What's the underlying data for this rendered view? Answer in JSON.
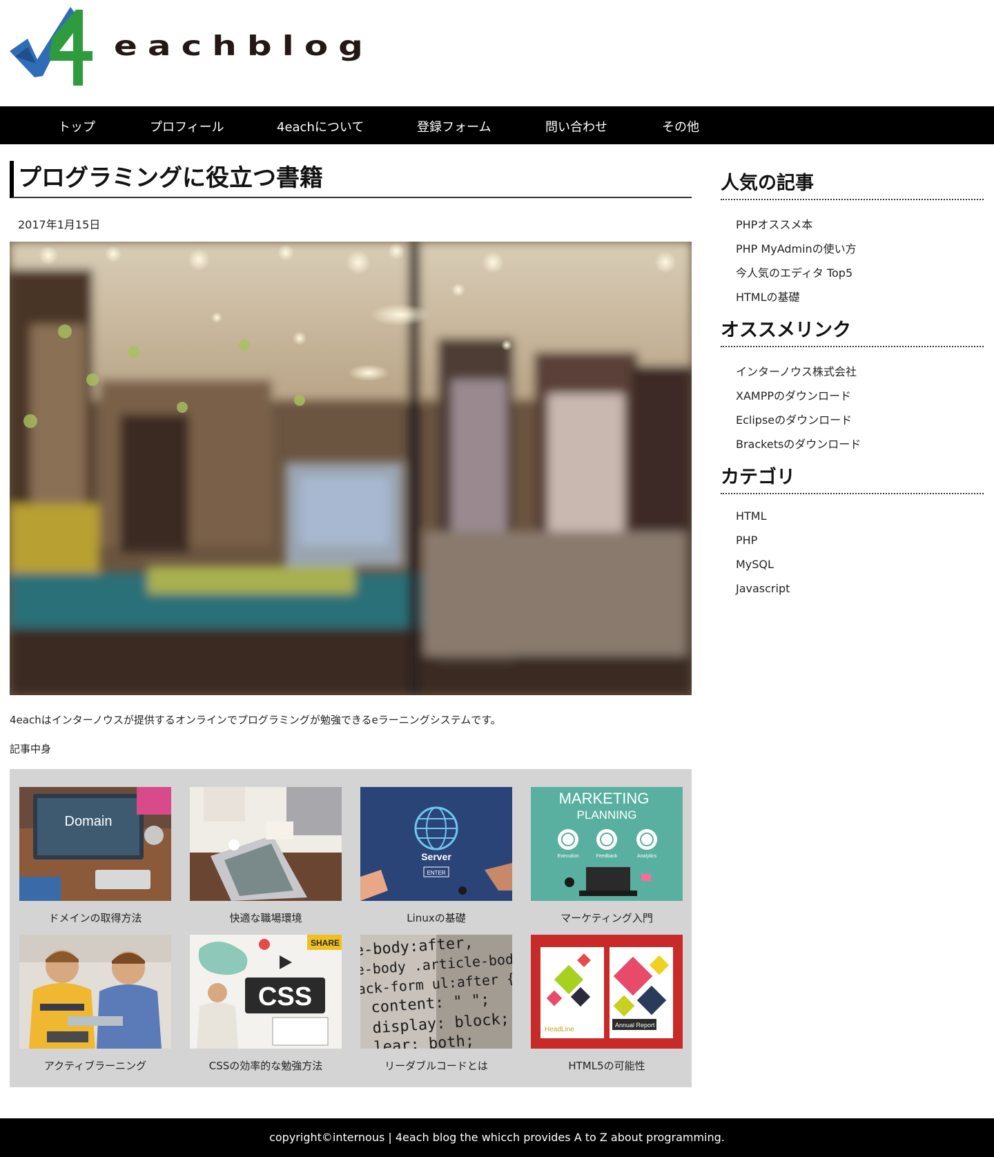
{
  "header": {
    "logo_text": "eachblog",
    "logo_mark": "4"
  },
  "nav": {
    "items": [
      "トップ",
      "プロフィール",
      "4eachについて",
      "登録フォーム",
      "問い合わせ",
      "その他"
    ]
  },
  "article": {
    "title": "プログラミングに役立つ書籍",
    "date": "2017年1月15日",
    "intro": "4eachはインターノウスが提供するオンラインでプログラミングが勉強できるeラーニングシステムです。",
    "body_label": "記事中身"
  },
  "cards": [
    {
      "caption": "ドメインの取得方法",
      "thumb_text": "Domain"
    },
    {
      "caption": "快適な職場環境"
    },
    {
      "caption": "Linuxの基礎",
      "thumb_text": "Server",
      "thumb_sub": "ENTER"
    },
    {
      "caption": "マーケティング入門",
      "thumb_text": "MARKETING",
      "thumb_sub": "PLANNING",
      "thumb_icons": [
        "Execution",
        "Feedback",
        "Analytics"
      ]
    },
    {
      "caption": "アクティブラーニング"
    },
    {
      "caption": "CSSの効率的な勉強方法",
      "thumb_text": "CSS",
      "thumb_sub": "SHARE"
    },
    {
      "caption": "リーダブルコードとは",
      "thumb_lines": [
        "e-body:after,",
        "e-body .article-body-more:a",
        "ack-form ul:after {",
        "content: \" \";",
        "display: block;",
        "lear: both;"
      ]
    },
    {
      "caption": "HTML5の可能性",
      "thumb_text": "HeadLine",
      "thumb_sub": "Annual Report"
    }
  ],
  "sidebar": {
    "popular": {
      "heading": "人気の記事",
      "items": [
        "PHPオススメ本",
        "PHP MyAdminの使い方",
        "今人気のエディタ Top5",
        "HTMLの基礎"
      ]
    },
    "links": {
      "heading": "オススメリンク",
      "items": [
        "インターノウス株式会社",
        "XAMPPのダウンロード",
        "Eclipseのダウンロード",
        "Bracketsのダウンロード"
      ]
    },
    "category": {
      "heading": "カテゴリ",
      "items": [
        "HTML",
        "PHP",
        "MySQL",
        "Javascript"
      ]
    }
  },
  "footer": {
    "text": "copyright©internous | 4each blog the whicch provides A to Z about programming."
  },
  "colors": {
    "nav_bg": "#000000",
    "grid_bg": "#d4d4d4",
    "logo_blue": "#2f6db5",
    "logo_green": "#2e9b3f"
  }
}
